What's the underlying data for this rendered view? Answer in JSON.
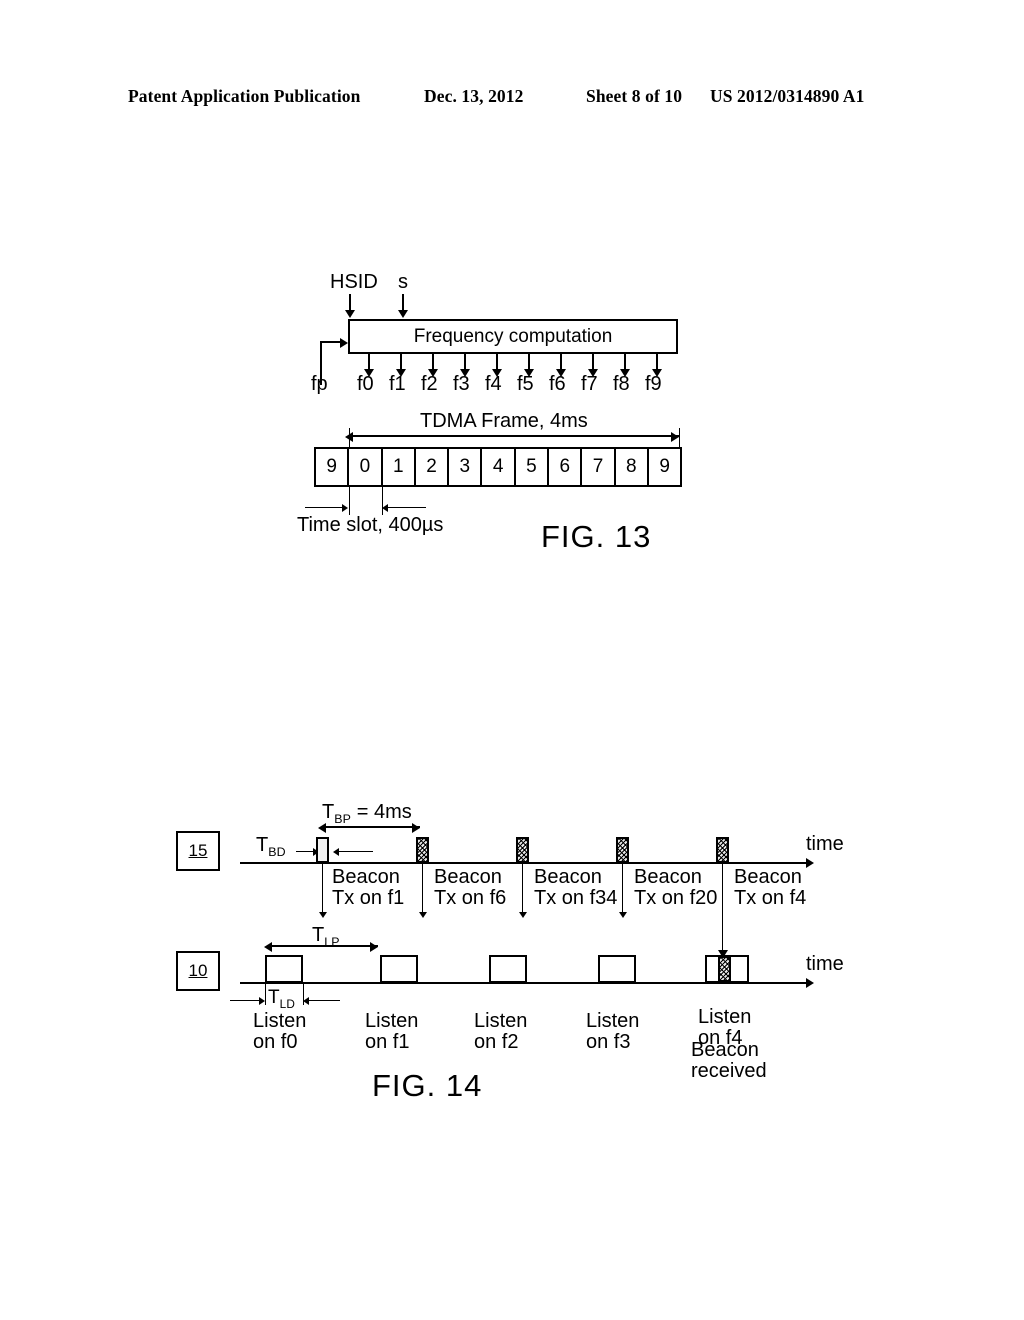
{
  "header": {
    "publication": "Patent Application Publication",
    "date": "Dec. 13, 2012",
    "sheet": "Sheet 8 of 10",
    "number": "US 2012/0314890 A1"
  },
  "fig13": {
    "title": "FIG. 13",
    "inputs": [
      {
        "label": "HSID"
      },
      {
        "label": "s"
      }
    ],
    "feedback_input": "fp",
    "block_label": "Frequency computation",
    "outputs": [
      "f0",
      "f1",
      "f2",
      "f3",
      "f4",
      "f5",
      "f6",
      "f7",
      "f8",
      "f9"
    ],
    "frame_label": "TDMA Frame, 4ms",
    "slots": [
      "9",
      "0",
      "1",
      "2",
      "3",
      "4",
      "5",
      "6",
      "7",
      "8",
      "9"
    ],
    "slot_label": "Time slot, 400µs"
  },
  "fig14": {
    "title": "FIG. 14",
    "beacon_row": {
      "ref": "15",
      "axis_label": "time",
      "period_label": "T",
      "period_sub": "BP",
      "period_value": " = 4ms",
      "duration_label": "T",
      "duration_sub": "BD",
      "events": [
        {
          "line1": "Beacon",
          "line2": "Tx on f1"
        },
        {
          "line1": "Beacon",
          "line2": "Tx on f6"
        },
        {
          "line1": "Beacon",
          "line2": "Tx on f34"
        },
        {
          "line1": "Beacon",
          "line2": "Tx on f20"
        },
        {
          "line1": "Beacon",
          "line2": "Tx on f4"
        }
      ]
    },
    "listen_row": {
      "ref": "10",
      "axis_label": "time",
      "period_label": "T",
      "period_sub": "LP",
      "duration_label": "T",
      "duration_sub": "LD",
      "events": [
        {
          "line1": "Listen",
          "line2": "on f0"
        },
        {
          "line1": "Listen",
          "line2": "on f1"
        },
        {
          "line1": "Listen",
          "line2": "on f2"
        },
        {
          "line1": "Listen",
          "line2": "on f3"
        },
        {
          "line1": "Listen",
          "line2": "on f4"
        }
      ],
      "received_note_line1": "Beacon",
      "received_note_line2": "received"
    }
  }
}
